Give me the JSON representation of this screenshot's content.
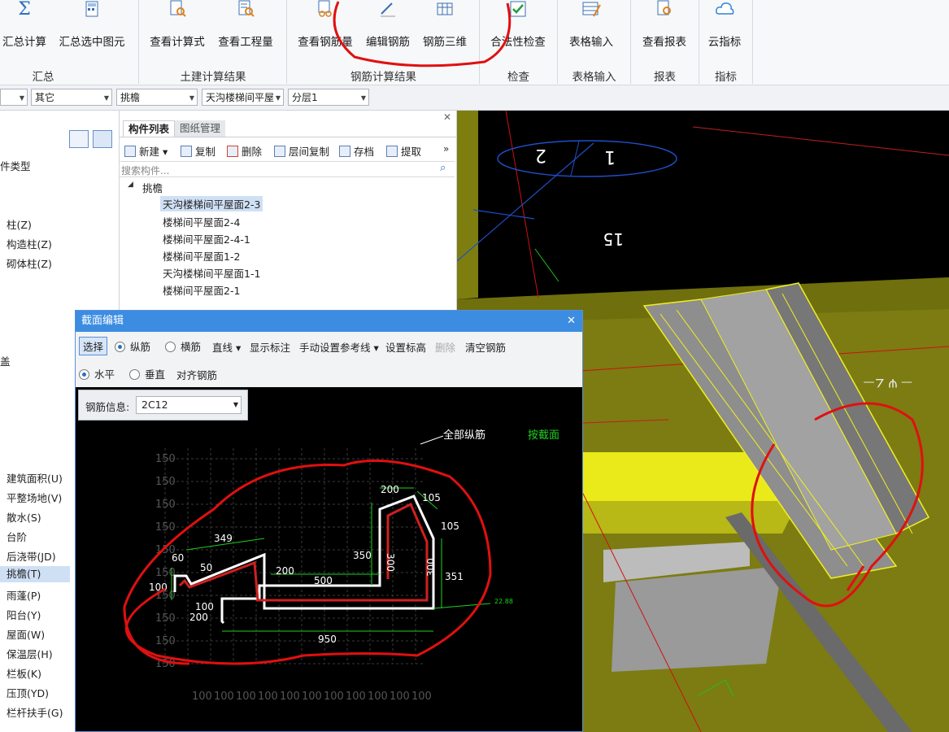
{
  "ribbon": {
    "buttons": [
      {
        "label": "汇总计算",
        "icon": "sigma-icon"
      },
      {
        "label": "汇总选中图元",
        "icon": "calculator-icon"
      },
      {
        "label": "查看计算式",
        "icon": "formula-view-icon"
      },
      {
        "label": "查看工程量",
        "icon": "quantity-view-icon"
      },
      {
        "label": "查看钢筋量",
        "icon": "rebar-quantity-icon"
      },
      {
        "label": "编辑钢筋",
        "icon": "edit-rebar-icon"
      },
      {
        "label": "钢筋三维",
        "icon": "rebar-3d-icon"
      },
      {
        "label": "合法性检查",
        "icon": "check-icon"
      },
      {
        "label": "表格输入",
        "icon": "table-input-icon"
      },
      {
        "label": "查看报表",
        "icon": "report-icon"
      },
      {
        "label": "云指标",
        "icon": "cloud-index-icon"
      }
    ],
    "groups": [
      "汇总",
      "土建计算结果",
      "钢筋计算结果",
      "检查",
      "表格输入",
      "报表",
      "指标"
    ]
  },
  "filters": {
    "floor_type": "",
    "category": "其它",
    "element": "挑檐",
    "component": "天沟楼梯间平屋",
    "layer": "分层1"
  },
  "left_tree": {
    "header": "件类型",
    "items": [
      "柱(Z)",
      "构造柱(Z)",
      "砌体柱(Z)",
      "盖",
      "建筑面积(U)",
      "平整场地(V)",
      "散水(S)",
      "台阶",
      "后浇带(JD)",
      "挑檐(T)",
      "雨蓬(P)",
      "阳台(Y)",
      "屋面(W)",
      "保温层(H)",
      "栏板(K)",
      "压顶(YD)",
      "栏杆扶手(G)"
    ],
    "selected": "挑檐(T)"
  },
  "component_list": {
    "tabs": [
      "构件列表",
      "图纸管理"
    ],
    "toolbar": [
      "新建",
      "复制",
      "删除",
      "层间复制",
      "存档",
      "提取"
    ],
    "search_placeholder": "搜索构件...",
    "group": "挑檐",
    "items": [
      "天沟楼梯间平屋面2-3",
      "楼梯间平屋面2-4",
      "楼梯间平屋面2-4-1",
      "楼梯间平屋面1-2",
      "天沟楼梯间平屋面1-1",
      "楼梯间平屋面2-1"
    ],
    "selected": "天沟楼梯间平屋面2-3"
  },
  "dialog": {
    "title": "截面编辑",
    "toolbar1": {
      "select": "选择",
      "longitudinal": "纵筋",
      "transverse": "横筋",
      "line": "直线",
      "show_dims": "显示标注",
      "manual_ref": "手动设置参考线",
      "set_elev": "设置标高",
      "delete": "删除",
      "clear": "清空钢筋"
    },
    "toolbar2": {
      "horizontal": "水平",
      "vertical": "垂直",
      "align": "对齐钢筋"
    },
    "rebar_info_label": "钢筋信息:",
    "rebar_info_value": "2C12",
    "canvas": {
      "all_longitudinal": "全部纵筋",
      "by_section": "按截面",
      "dims": [
        "349",
        "60",
        "50",
        "100",
        "100",
        "200",
        "200",
        "500",
        "350",
        "200",
        "105",
        "105",
        "300",
        "351",
        "950",
        "300",
        "22.88"
      ],
      "grid_left_labels": [
        "150",
        "150",
        "150",
        "150",
        "150",
        "150",
        "150",
        "150",
        "150",
        "150"
      ],
      "grid_bottom_labels": [
        "100",
        "100",
        "100",
        "100",
        "100",
        "100",
        "100",
        "100",
        "100",
        "100",
        "100"
      ]
    }
  },
  "viewport": {
    "labels": [
      "2",
      "1",
      "15"
    ]
  },
  "colors": {
    "accent": "#3c8ce2",
    "annotation_red": "#e01010",
    "rebar_white": "#ffffff",
    "rebar_red": "#d02020",
    "dimension_green": "#20d020",
    "model_olive": "#8a8a14",
    "highlight_yellow": "#f0f020"
  }
}
